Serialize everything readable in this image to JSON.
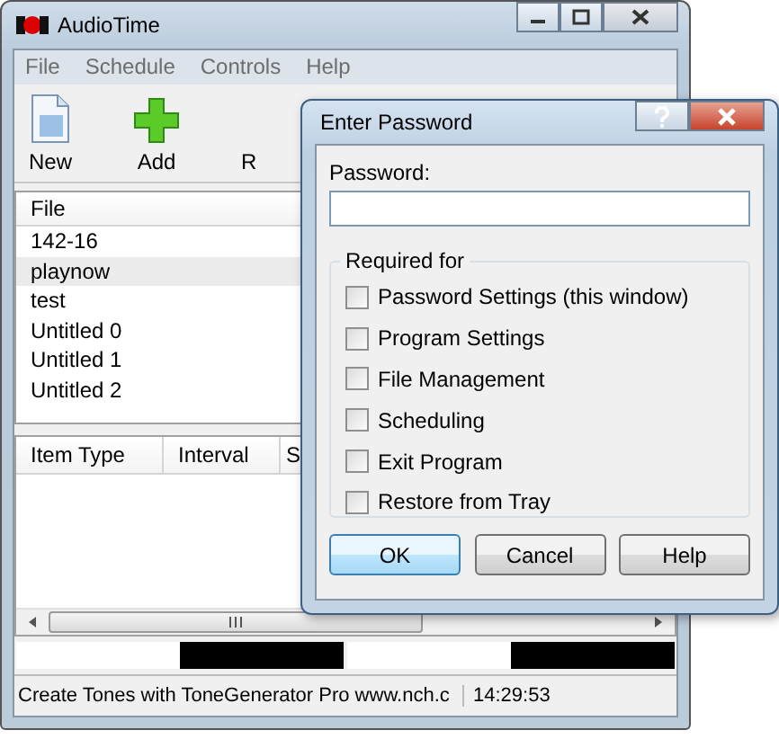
{
  "main_window": {
    "title": "AudioTime",
    "menu": [
      "File",
      "Schedule",
      "Controls",
      "Help"
    ],
    "toolbar": [
      {
        "label": "New",
        "kind": "new"
      },
      {
        "label": "Add",
        "kind": "add"
      },
      {
        "label": "R",
        "kind": "covered"
      }
    ],
    "file_list": {
      "header": "File",
      "items": [
        {
          "label": "142-16",
          "selected": false
        },
        {
          "label": "playnow",
          "selected": true
        },
        {
          "label": "test",
          "selected": false
        },
        {
          "label": "Untitled 0",
          "selected": false
        },
        {
          "label": "Untitled 1",
          "selected": false
        },
        {
          "label": "Untitled 2",
          "selected": false
        }
      ]
    },
    "schedule_table": {
      "columns": [
        "Item Type",
        "Interval",
        "S"
      ]
    },
    "meters": [
      {
        "level": 0.5
      },
      {
        "level": 0.5
      }
    ],
    "status_bar": {
      "message": "Create Tones with ToneGenerator Pro www.nch.c",
      "time": "14:29:53"
    }
  },
  "dialog": {
    "title": "Enter Password",
    "password_label": "Password:",
    "group_title": "Required for",
    "options": [
      {
        "label": "Password Settings (this window)",
        "checked": false
      },
      {
        "label": "Program Settings",
        "checked": false
      },
      {
        "label": "File Management",
        "checked": false
      },
      {
        "label": "Scheduling",
        "checked": false
      },
      {
        "label": "Exit Program",
        "checked": false
      },
      {
        "label": "Restore from Tray",
        "checked": false
      }
    ],
    "buttons": [
      {
        "label": "OK",
        "default": true
      },
      {
        "label": "Cancel",
        "default": false
      },
      {
        "label": "Help",
        "default": false
      }
    ]
  }
}
